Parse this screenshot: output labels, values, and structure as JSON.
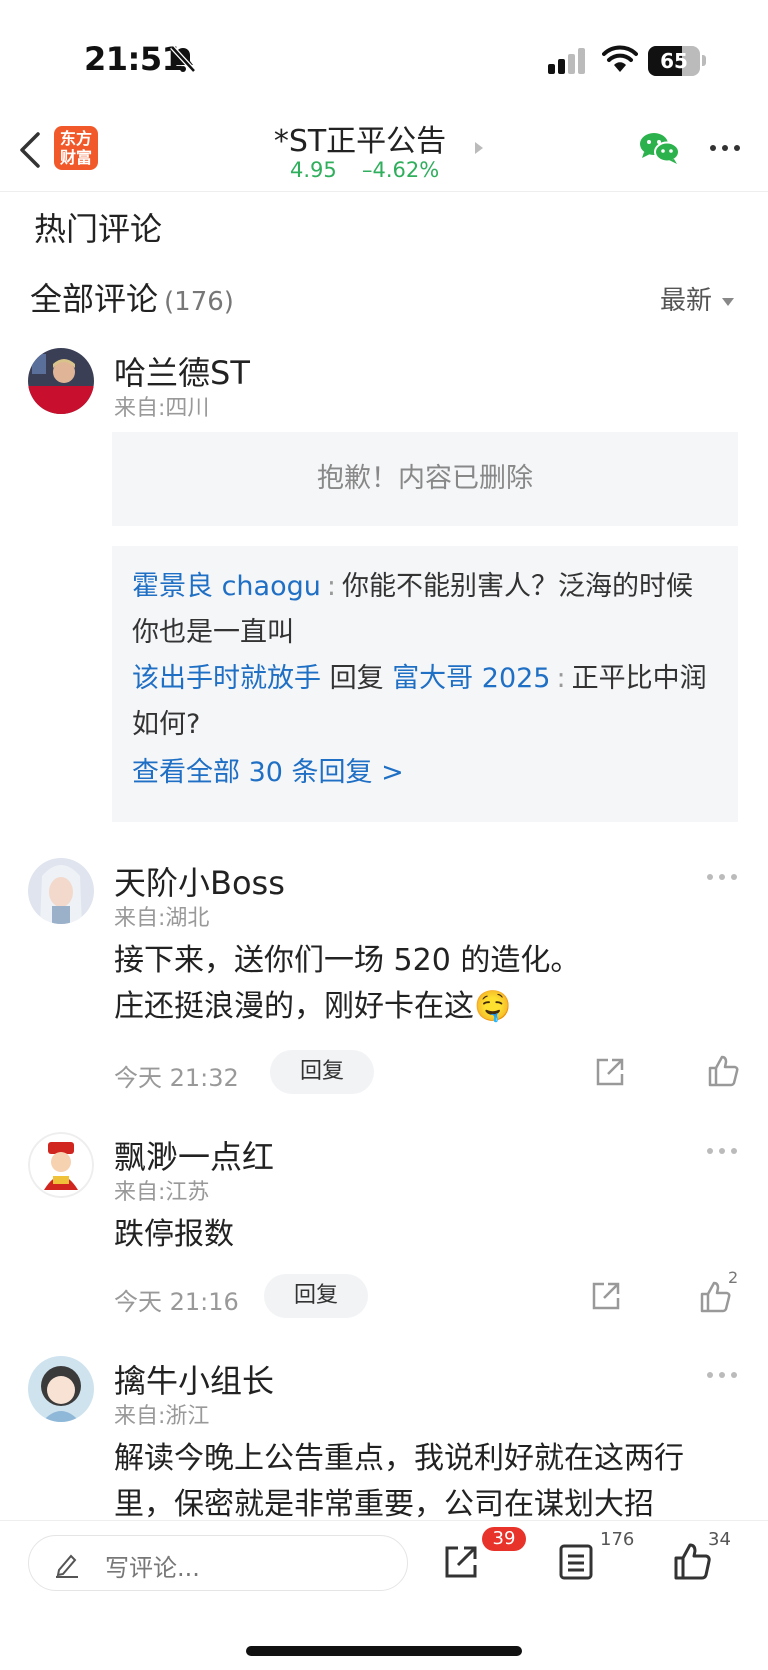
{
  "status_bar": {
    "time": "21:51",
    "battery": "65",
    "battery_level": 0.65
  },
  "header": {
    "logo_text": "东方财富",
    "title": "*ST正平公告",
    "price": "4.95",
    "change": "–4.62%"
  },
  "sections": {
    "hot": "热门评论",
    "all": "全部评论",
    "all_count": "(176)",
    "sort": "最新"
  },
  "comments": [
    {
      "user": "哈兰德ST",
      "from": "来自:四川",
      "deleted_text": "抱歉！内容已删除",
      "replies": {
        "r1_user": "霍景良 chaogu",
        "r1_colon": ":",
        "r1_text": "你能不能别害人？泛海的时候你也是一直叫",
        "r2_user": "该出手时就放手",
        "r2_mid": "回复",
        "r2_target": "富大哥 2025",
        "r2_colon": ":",
        "r2_text": "正平比中润如何?",
        "view_all": "查看全部 30 条回复 >"
      }
    },
    {
      "user": "天阶小Boss",
      "from": "来自:湖北",
      "line1": "接下来，送你们一场 520 的造化。",
      "line2": "庄还挺浪漫的，刚好卡在这🤤",
      "time": "今天 21:32",
      "reply_label": "回复"
    },
    {
      "user": "飘渺一点红",
      "from": "来自:江苏",
      "line1": "跌停报数",
      "time": "今天 21:16",
      "reply_label": "回复",
      "likes": "2"
    },
    {
      "user": "擒牛小组长",
      "from": "来自:浙江",
      "line1": "解读今晚上公告重点，我说利好就在这两行",
      "line2": "里，保密就是非常重要，公司在谋划大招"
    }
  ],
  "bottom_bar": {
    "input_placeholder": "写评论...",
    "share_badge": "39",
    "comment_count": "176",
    "like_count": "34"
  },
  "colors": {
    "brand": "#f2592a",
    "down_green": "#2fae5c",
    "link_blue": "#1f6fc5",
    "badge_red": "#e8332a"
  }
}
